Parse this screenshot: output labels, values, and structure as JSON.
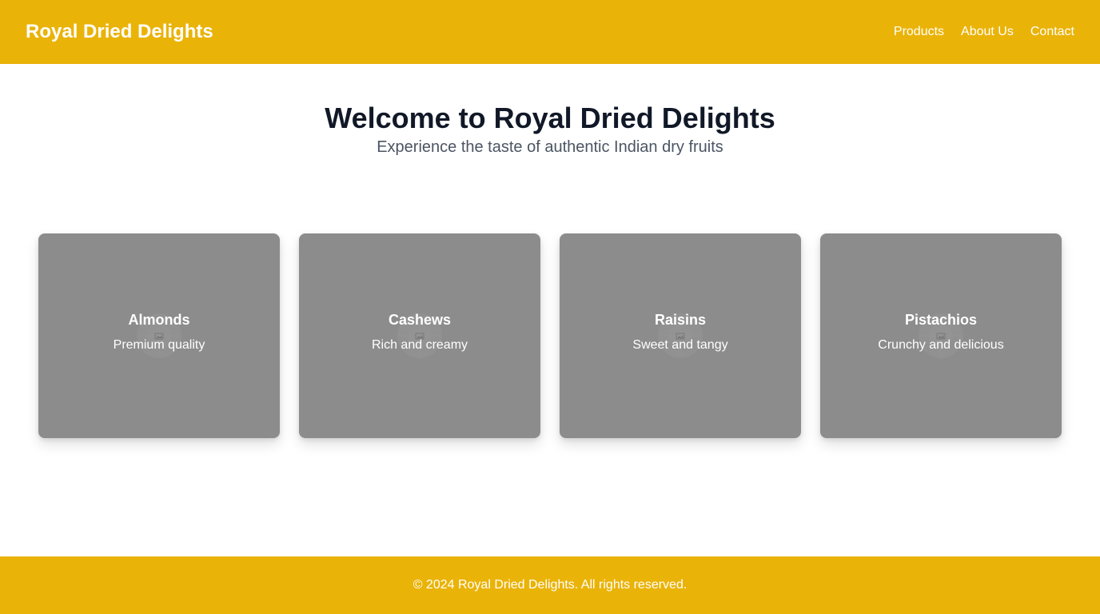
{
  "header": {
    "brand": "Royal Dried Delights",
    "nav": [
      "Products",
      "About Us",
      "Contact"
    ]
  },
  "hero": {
    "title": "Welcome to Royal Dried Delights",
    "subtitle": "Experience the taste of authentic Indian dry fruits"
  },
  "products": [
    {
      "name": "Almonds",
      "description": "Premium quality",
      "icon": "image-placeholder-icon"
    },
    {
      "name": "Cashews",
      "description": "Rich and creamy",
      "icon": "image-placeholder-icon"
    },
    {
      "name": "Raisins",
      "description": "Sweet and tangy",
      "icon": "image-placeholder-icon"
    },
    {
      "name": "Pistachios",
      "description": "Crunchy and delicious",
      "icon": "image-placeholder-icon"
    }
  ],
  "footer": {
    "text": "© 2024 Royal Dried Delights. All rights reserved."
  },
  "colors": {
    "accent": "#eab308",
    "card_overlay": "#8c8c8c",
    "heading": "#111827",
    "subheading": "#4b5563"
  }
}
